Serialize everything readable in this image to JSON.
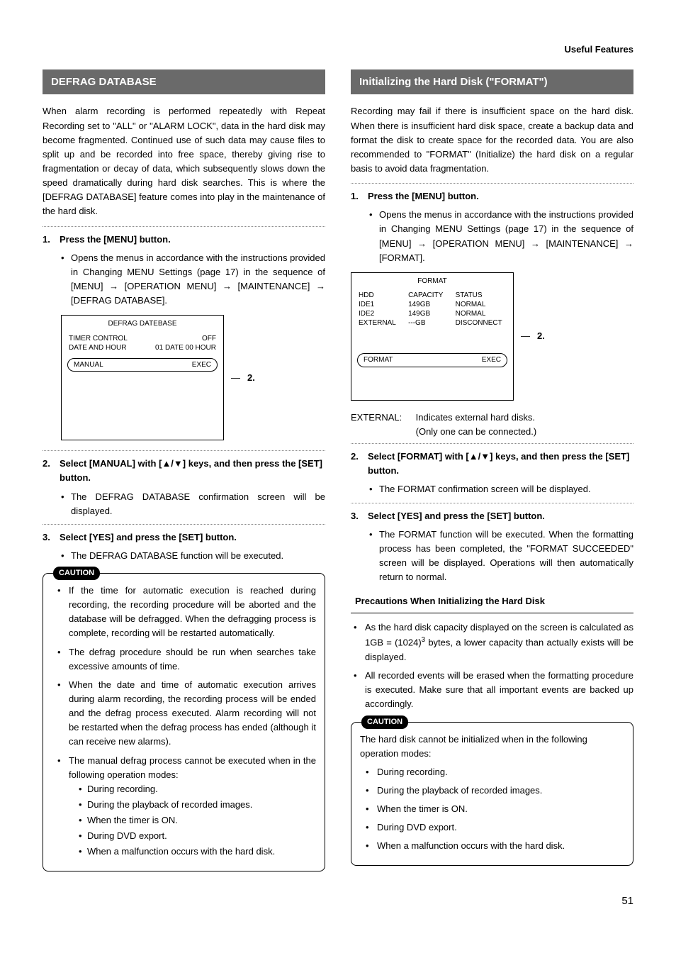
{
  "header": {
    "section": "Useful Features"
  },
  "page_number": "51",
  "left": {
    "title": "DEFRAG DATABASE",
    "intro": "When alarm recording is performed repeatedly with Repeat Recording set to \"ALL\" or \"ALARM LOCK\", data in the hard disk may become fragmented. Continued use of such data may cause files to split up and be recorded into free space, thereby giving rise to fragmentation or decay of data, which subsequently slows down the speed dramatically during hard disk searches. This is where the [DEFRAG DATABASE] feature comes into play in the maintenance of the hard disk.",
    "step1": {
      "num": "1.",
      "title": "Press the [MENU] button.",
      "bullet": "Opens the menus in accordance with the instructions provided in Changing MENU Settings (page 17) in the sequence of [MENU] → [OPERATION MENU] → [MAINTENANCE] → [DEFRAG DATABASE]."
    },
    "ui": {
      "title": "DEFRAG DATEBASE",
      "row1l": "TIMER CONTROL",
      "row1r": "OFF",
      "row2l": "DATE AND HOUR",
      "row2r": "01 DATE 00 HOUR",
      "btn_l": "MANUAL",
      "btn_r": "EXEC",
      "callout": "2."
    },
    "step2": {
      "num": "2.",
      "title": "Select [MANUAL] with [▲/▼] keys, and then press the [SET] button.",
      "bullet": "The DEFRAG DATABASE confirmation screen will be displayed."
    },
    "step3": {
      "num": "3.",
      "title": "Select [YES] and press the [SET] button.",
      "bullet": "The DEFRAG DATABASE function will be executed."
    },
    "caution": {
      "label": "CAUTION",
      "items": [
        "If the time for automatic execution is reached during recording, the recording procedure will be aborted and the database will be defragged. When the defragging process is complete, recording will be restarted automatically.",
        "The defrag procedure should be run when searches take excessive amounts of time.",
        "When the date and time of automatic execution arrives during alarm recording, the recording process will be ended and the defrag process executed. Alarm recording will not be restarted when the defrag process has ended (although it can receive new alarms).",
        "The manual defrag process cannot be executed when in the following operation modes:"
      ],
      "sub": [
        "During recording.",
        "During the playback of recorded images.",
        "When the timer is ON.",
        "During DVD export.",
        "When a malfunction occurs with the hard disk."
      ]
    }
  },
  "right": {
    "title": "Initializing the Hard Disk (\"FORMAT\")",
    "intro": "Recording may fail if there is insufficient space on the hard disk. When there is insufficient hard disk space, create a backup data and format the disk to create space for the recorded data. You are also recommended to \"FORMAT\" (Initialize) the hard disk on a regular basis to avoid data fragmentation.",
    "step1": {
      "num": "1.",
      "title": "Press the [MENU] button.",
      "bullet": "Opens the menus in accordance with the instructions provided in Changing MENU Settings (page 17) in the sequence of [MENU] → [OPERATION MENU] → [MAINTENANCE] → [FORMAT]."
    },
    "ui": {
      "title": "FORMAT",
      "h1": "HDD",
      "h2": "CAPACITY",
      "h3": "STATUS",
      "r1a": "IDE1",
      "r1b": "149GB",
      "r1c": "NORMAL",
      "r2a": "IDE2",
      "r2b": "149GB",
      "r2c": "NORMAL",
      "r3a": "EXTERNAL",
      "r3b": "---GB",
      "r3c": "DISCONNECT",
      "btn_l": "FORMAT",
      "btn_r": "EXEC",
      "callout": "2."
    },
    "ext_lbl": "EXTERNAL:",
    "ext_l1": "Indicates external hard disks.",
    "ext_l2": "(Only one can be connected.)",
    "step2": {
      "num": "2.",
      "title": "Select [FORMAT] with [▲/▼] keys, and then press the [SET] button.",
      "bullet": "The FORMAT confirmation screen will be displayed."
    },
    "step3": {
      "num": "3.",
      "title": "Select [YES] and press the [SET] button.",
      "bullet": "The FORMAT function will be executed. When the formatting process has been completed, the \"FORMAT SUCCEEDED\" screen will be displayed. Operations will then automatically return to normal."
    },
    "precautions_title": "Precautions When Initializing the Hard Disk",
    "prec_pre": "As the hard disk capacity displayed on the screen is calculated as 1GB = (1024)",
    "prec_sup": "3",
    "prec_post": " bytes, a lower capacity than actually exists will be displayed.",
    "prec2": "All recorded events will be erased when the formatting procedure is executed. Make sure that all important events are backed up accordingly.",
    "caution": {
      "label": "CAUTION",
      "lead": "The hard disk cannot be initialized when in the following operation modes:",
      "items": [
        "During recording.",
        "During the playback of recorded images.",
        "When the timer is ON.",
        "During DVD export.",
        "When a malfunction occurs with the hard disk."
      ]
    }
  }
}
